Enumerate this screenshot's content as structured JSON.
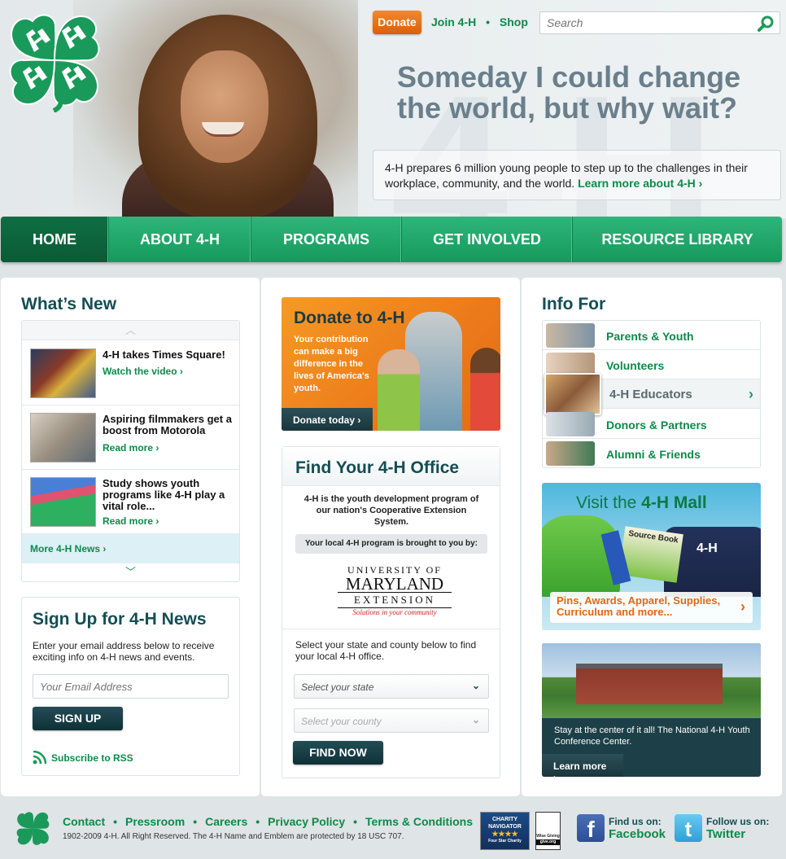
{
  "header": {
    "bg_text": "4-H",
    "donate_label": "Donate",
    "links": [
      "Join 4-H",
      "Shop"
    ],
    "search_placeholder": "Search",
    "headline": "Someday I could change the world, but why wait?",
    "intro_text": "4-H prepares 6 million young people to step up to the challenges in their workplace, community, and the world.",
    "intro_link": "Learn more about 4-H ›"
  },
  "nav": {
    "items": [
      "HOME",
      "ABOUT 4-H",
      "PROGRAMS",
      "GET INVOLVED",
      "RESOURCE LIBRARY"
    ]
  },
  "whats_new": {
    "title": "What’s New",
    "items": [
      {
        "title": "4-H takes Times Square!",
        "link": "Watch the video ›"
      },
      {
        "title": "Aspiring filmmakers get a boost from Motorola",
        "link": "Read more ›"
      },
      {
        "title": "Study shows youth programs like 4-H play a vital role...",
        "link": "Read more ›"
      }
    ],
    "more_link": "More 4-H News ›"
  },
  "signup": {
    "title": "Sign Up for 4-H News",
    "text": "Enter your email address below to receive exciting info on 4-H news and events.",
    "email_placeholder": "Your Email Address",
    "button": "SIGN UP",
    "rss": "Subscribe to RSS"
  },
  "donate_banner": {
    "title": "Donate to 4-H",
    "text": "Your contribution can make a big difference in the lives of America's youth.",
    "button": "Donate today ›"
  },
  "find_office": {
    "title": "Find Your 4-H Office",
    "text": "4-H is the youth development program of our nation's Cooperative Extension System.",
    "brought_by": "Your local 4-H program is brought to you by:",
    "uni_line1": "UNIVERSITY OF",
    "uni_line2": "MARYLAND",
    "uni_line3": "EXTENSION",
    "uni_tagline": "Solutions in your community",
    "select_text": "Select your state and county below to find your local 4-H office.",
    "state_placeholder": "Select your state",
    "county_placeholder": "Select your county",
    "button": "FIND NOW"
  },
  "info_for": {
    "title": "Info For",
    "items": [
      "Parents & Youth",
      "Volunteers",
      "4-H Educators",
      "Donors & Partners",
      "Alumni & Friends"
    ]
  },
  "mall": {
    "title_pre": "Visit the",
    "title_bold": "4-H Mall",
    "book_label": "Source Book",
    "shirt_text": "4-H",
    "caption": "Pins, Awards, Apparel, Supplies, Curriculum and more..."
  },
  "conference": {
    "text": "Stay at the center of it all! The National 4-H Youth Conference Center.",
    "button": "Learn more ›"
  },
  "footer": {
    "links": [
      "Contact",
      "Pressroom",
      "Careers",
      "Privacy Policy",
      "Terms & Conditions"
    ],
    "copyright": "1902-2009 4-H. All Right Reserved. The 4-H Name and Emblem are protected by 18 USC 707.",
    "badge1_line1": "CHARITY",
    "badge1_line2": "NAVIGATOR",
    "badge1_line3": "Four Star Charity",
    "badge2_line1": "Wise Giving",
    "badge2_line2": "give.org",
    "facebook_small": "Find us on:",
    "facebook": "Facebook",
    "twitter_small": "Follow us on:",
    "twitter": "Twitter"
  },
  "colors": {
    "brand_green": "#0d8a4a",
    "nav_green": "#1fa566",
    "dark_teal": "#134e53",
    "orange": "#ec7a1a"
  }
}
